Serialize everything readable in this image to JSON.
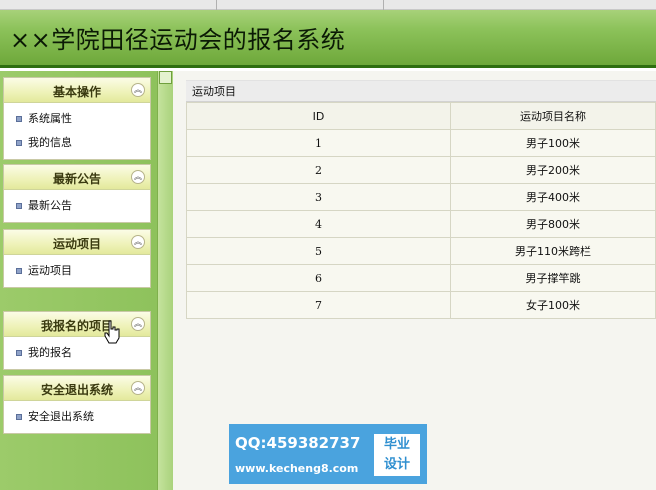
{
  "header": {
    "title": "××学院田径运动会的报名系统"
  },
  "sidebar": {
    "panels": [
      {
        "title": "基本操作",
        "items": [
          "系统属性",
          "我的信息"
        ]
      },
      {
        "title": "最新公告",
        "items": [
          "最新公告"
        ]
      },
      {
        "title": "运动项目",
        "items": [
          "运动项目"
        ]
      },
      {
        "title": "我报名的项目",
        "items": [
          "我的报名"
        ]
      },
      {
        "title": "安全退出系统",
        "items": [
          "安全退出系统"
        ]
      }
    ]
  },
  "main": {
    "breadcrumb": "运动项目",
    "table": {
      "columns": [
        "ID",
        "运动项目名称"
      ],
      "rows": [
        [
          "1",
          "男子100米"
        ],
        [
          "2",
          "男子200米"
        ],
        [
          "3",
          "男子400米"
        ],
        [
          "4",
          "男子800米"
        ],
        [
          "5",
          "男子110米跨栏"
        ],
        [
          "6",
          "男子撑竿跳"
        ],
        [
          "7",
          "女子100米"
        ]
      ]
    }
  },
  "watermark": {
    "qq": "QQ:459382737",
    "url": "www.kecheng8.com",
    "badge_line1": "毕业",
    "badge_line2": "设计"
  },
  "colors": {
    "header_green": "#8cc25a",
    "sidebar_green": "#9ccb6a",
    "watermark_blue": "#4aa3de"
  }
}
